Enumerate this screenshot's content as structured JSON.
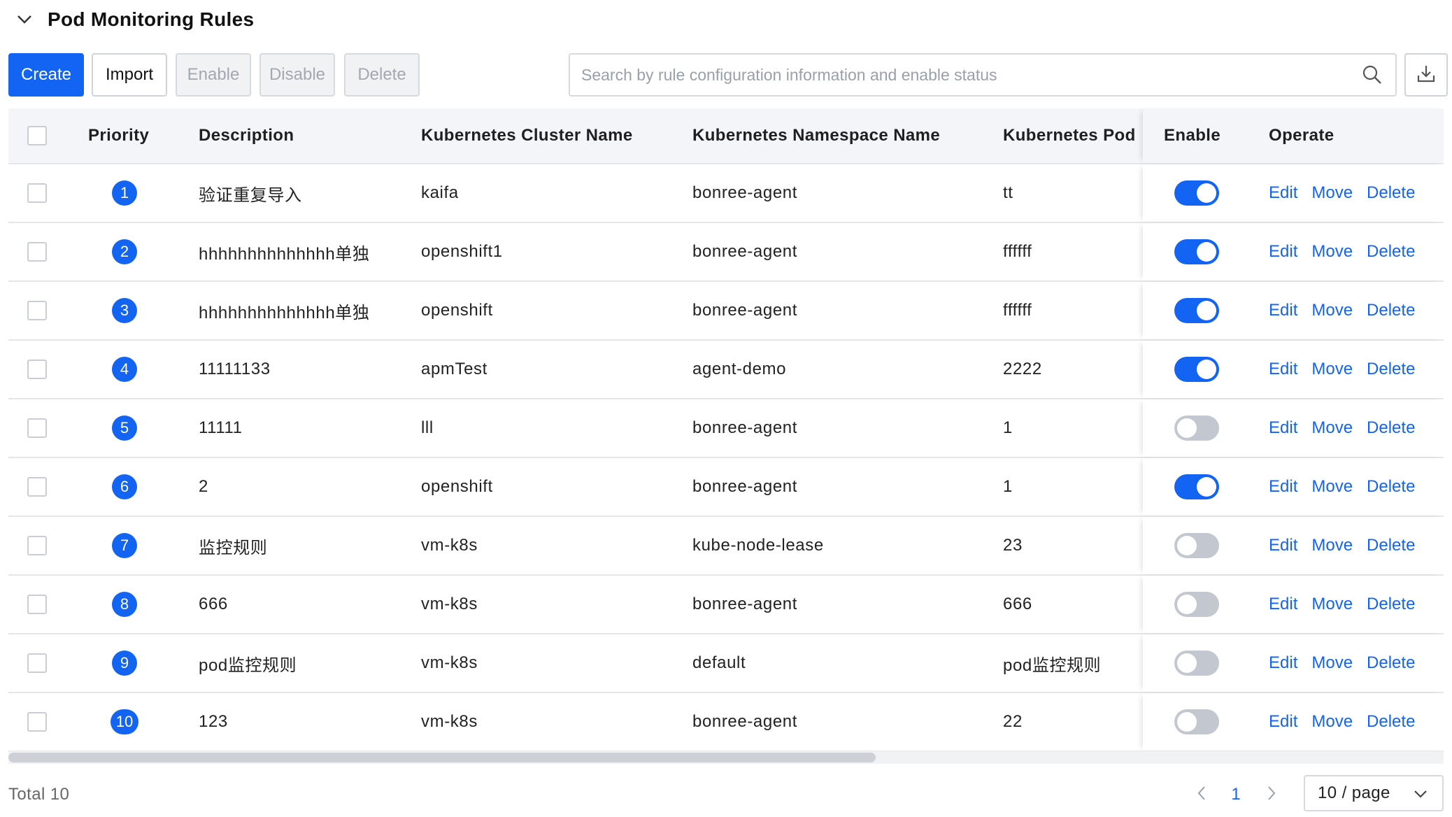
{
  "section": {
    "title": "Pod Monitoring Rules"
  },
  "toolbar": {
    "create": "Create",
    "import": "Import",
    "enable": "Enable",
    "disable": "Disable",
    "delete": "Delete",
    "search_placeholder": "Search by rule configuration information and enable status"
  },
  "table": {
    "columns": {
      "priority": "Priority",
      "description": "Description",
      "cluster": "Kubernetes Cluster Name",
      "namespace": "Kubernetes Namespace Name",
      "pod": "Kubernetes Pod",
      "enable": "Enable",
      "operate": "Operate"
    },
    "actions": {
      "edit": "Edit",
      "move": "Move",
      "delete": "Delete"
    },
    "rows": [
      {
        "priority": "1",
        "description": "验证重复导入",
        "cluster": "kaifa",
        "namespace": "bonree-agent",
        "pod": "tt",
        "enabled": true
      },
      {
        "priority": "2",
        "description": "hhhhhhhhhhhhhh单独",
        "cluster": "openshift1",
        "namespace": "bonree-agent",
        "pod": "ffffff",
        "enabled": true
      },
      {
        "priority": "3",
        "description": "hhhhhhhhhhhhhh单独",
        "cluster": "openshift",
        "namespace": "bonree-agent",
        "pod": "ffffff",
        "enabled": true
      },
      {
        "priority": "4",
        "description": "11111133",
        "cluster": "apmTest",
        "namespace": "agent-demo",
        "pod": "2222",
        "enabled": true
      },
      {
        "priority": "5",
        "description": "11111",
        "cluster": "lll",
        "namespace": "bonree-agent",
        "pod": "1",
        "enabled": false
      },
      {
        "priority": "6",
        "description": "2",
        "cluster": "openshift",
        "namespace": "bonree-agent",
        "pod": "1",
        "enabled": true
      },
      {
        "priority": "7",
        "description": "监控规则",
        "cluster": "vm-k8s",
        "namespace": "kube-node-lease",
        "pod": "23",
        "enabled": false
      },
      {
        "priority": "8",
        "description": "666",
        "cluster": "vm-k8s",
        "namespace": "bonree-agent",
        "pod": "666",
        "enabled": false
      },
      {
        "priority": "9",
        "description": "pod监控规则",
        "cluster": "vm-k8s",
        "namespace": "default",
        "pod": "pod监控规则",
        "enabled": false
      },
      {
        "priority": "10",
        "description": "123",
        "cluster": "vm-k8s",
        "namespace": "bonree-agent",
        "pod": "22",
        "enabled": false
      }
    ]
  },
  "footer": {
    "total": "Total 10",
    "current_page": "1",
    "page_size": "10 / page"
  },
  "colors": {
    "primary": "#1364f2",
    "toggle_off": "#c3c7cf",
    "header_bg": "#f4f5f8"
  }
}
